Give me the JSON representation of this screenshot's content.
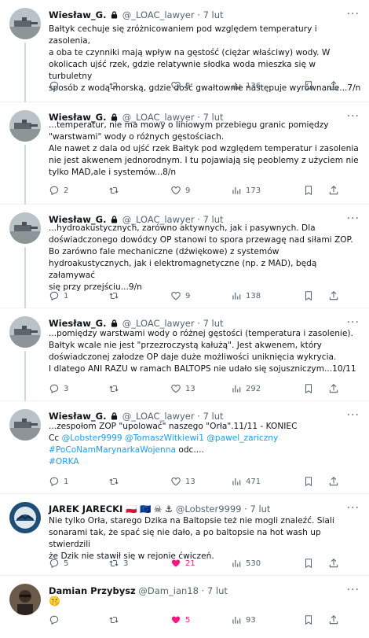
{
  "tweets": [
    {
      "name": "Wiesław_G.",
      "handle": "@_LOAC_lawyer",
      "sep": "·",
      "time": "7 lut",
      "lines": [
        "Bałtyk cechuje się zróżnicowaniem pod względem temperatury i zasolenia,",
        "a oba te czynniki mają wpływ na gęstość (ciężar właściwy) wody. W",
        "okolicach ujść rzek, gdzie relatywnie słodka woda mieszka się w turbuletny",
        "sposób z wodą morską, gdzie dość gwałtownie następuje wyrównanie...7/n"
      ],
      "replies": "",
      "retweets": "",
      "likes": "9",
      "views": "136"
    },
    {
      "name": "Wiesław_G.",
      "handle": "@_LOAC_lawyer",
      "sep": "·",
      "time": "7 lut",
      "lines": [
        "...temperatur, nie ma mowy o liniowym przebiegu granic pomiędzy",
        "\"warstwami\" wody o różnych gęstościach.",
        "Ale nawet z dala od ujść rzek Bałtyk pod względem temperatur i zasolenia",
        "nie jest akwenem jednorodnym. I tu pojawiają się peoblemy z użyciem nie",
        "tylko MAD,ale i systemów...8/n"
      ],
      "replies": "2",
      "retweets": "",
      "likes": "9",
      "views": "173"
    },
    {
      "name": "Wiesław_G.",
      "handle": "@_LOAC_lawyer",
      "sep": "·",
      "time": "7 lut",
      "lines": [
        "...hydroakustycznych, zarówno aktywnych, jak i pasywnych. Dla",
        "doświadczonego dowódcy OP stanowi to spora przewagę nad siłami ZOP.",
        "Bo zarówno fale mechaniczne (dźwiękowe) z systemów",
        "hydroakustycznych, jak i elektromagnetyczne (np. z MAD), będą załamywać",
        "się przy przejściu...9/n"
      ],
      "replies": "1",
      "retweets": "",
      "likes": "9",
      "views": "138"
    },
    {
      "name": "Wiesław_G.",
      "handle": "@_LOAC_lawyer",
      "sep": "·",
      "time": "7 lut",
      "lines": [
        "...pomiędzy warstwami wody o różnej gęstości (temperatura i zasolenie).",
        "Bałtyk wcale nie jest \"przezroczystą kałużą\". Jest akwenem, który",
        "doświadczonej załodze OP daje duże możliwości uniknięcia wykrycia.",
        "I dlatego ANI RAZU w ramach BALTOPS nie udało się sojuszniczym...10/11"
      ],
      "replies": "3",
      "retweets": "",
      "likes": "13",
      "views": "292"
    },
    {
      "name": "Wiesław_G.",
      "handle": "@_LOAC_lawyer",
      "sep": "·",
      "time": "7 lut",
      "line1": "...zespołom ZOP \"upolować\" naszego \"Orła\".11/11 - KONIEC",
      "cc": "Cc",
      "mentions": [
        "@Lobster9999",
        "@TomaszWitkiewi1",
        "@pawel_zariczny"
      ],
      "hashtag1": "#PoCoNamMarynarkaWojenna",
      "more_text": "odc....",
      "hashtag2": "#ORKA",
      "replies": "1",
      "retweets": "",
      "likes": "13",
      "views": "471"
    },
    {
      "name": "JAREK JARECKI",
      "flags": "🇵🇱 🇪🇺 ☠ ⚓",
      "handle": "@Lobster9999",
      "sep": "·",
      "time": "7 lut",
      "lines": [
        "Nie tylko Orła, starego Dzika na Baltopsie też nie mogli znaleźć. Siali",
        "sonarami tak, że spać się nie dało, a po baltopsie na hot wash up stwierdzili",
        "że Dzik nie stawił się w rejonie ćwiczeń."
      ],
      "replies": "5",
      "retweets": "3",
      "likes": "21",
      "views": "530"
    },
    {
      "name": "Damian Przybysz",
      "handle": "@Dam_ian18",
      "sep": "·",
      "time": "7 lut",
      "emoji": "🤫",
      "replies": "",
      "retweets": "",
      "likes": "5",
      "views": "93"
    }
  ],
  "colors": {
    "accent": "#1d9bf0",
    "like_active": "#f91880",
    "muted": "#536471",
    "border": "#eff3f4"
  }
}
